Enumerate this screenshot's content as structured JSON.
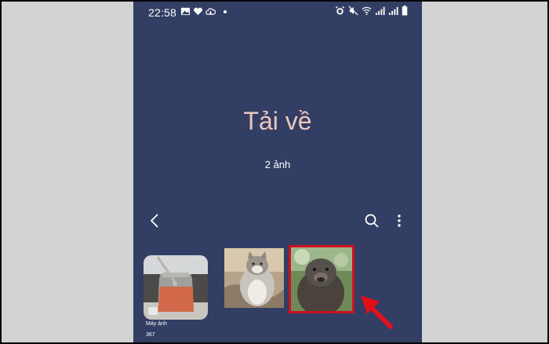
{
  "status_bar": {
    "time": "22:58",
    "left_icons": [
      "image-icon",
      "heart-icon",
      "cloud-icon",
      "dot-icon"
    ],
    "right_icons": [
      "alarm-icon",
      "mute-icon",
      "wifi-icon",
      "signal-icon",
      "signal-icon",
      "battery-icon"
    ]
  },
  "album": {
    "title": "Tải về",
    "count": "2 ảnh"
  },
  "toolbar": {
    "back_icon": "back-icon",
    "search_icon": "search-icon",
    "more_icon": "more-vertical-icon"
  },
  "thumbnails": [
    {
      "label": "Máy ảnh",
      "count": "367",
      "kind": "album"
    },
    {
      "kind": "photo"
    },
    {
      "kind": "photo",
      "highlighted": true
    }
  ],
  "colors": {
    "background": "#323e63",
    "title": "#ecc6bf",
    "highlight": "#d0101e",
    "frame": "#d3d3d3"
  }
}
